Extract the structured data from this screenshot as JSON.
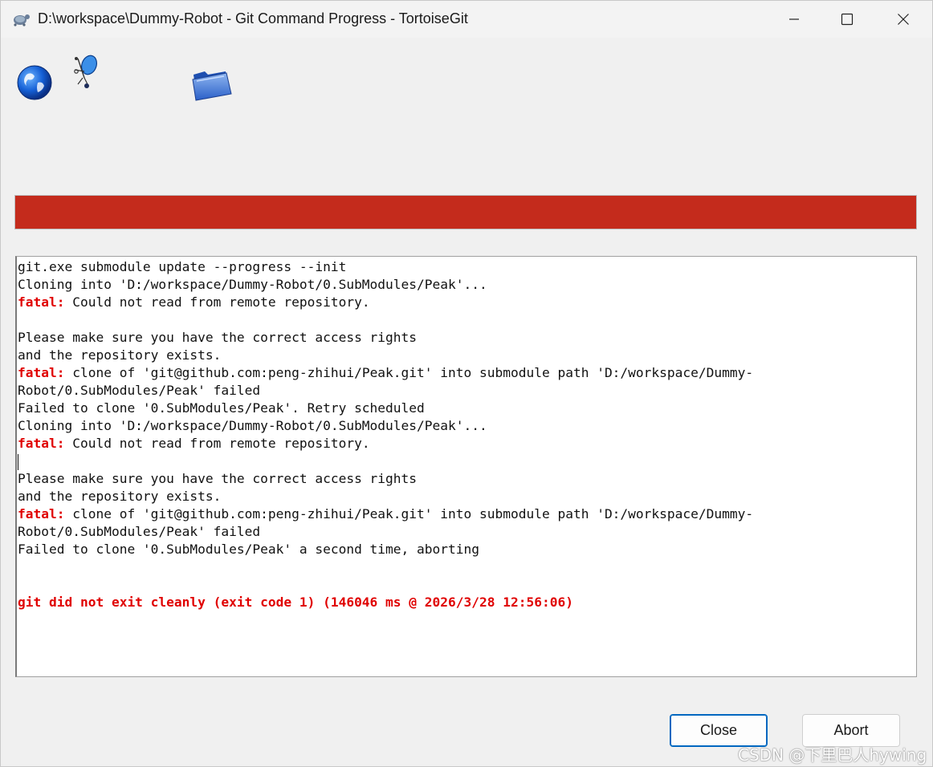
{
  "window": {
    "title": "D:\\workspace\\Dummy-Robot - Git Command Progress - TortoiseGit"
  },
  "icons": {
    "app": "tortoise-icon",
    "source": "globe-icon",
    "robot": "robot-icon",
    "destination": "folder-icon"
  },
  "progress": {
    "value": 1.0,
    "color": "#c42b1c"
  },
  "log": {
    "lines": [
      {
        "prefix": "",
        "text": "git.exe submodule update --progress --init"
      },
      {
        "prefix": "",
        "text": "Cloning into 'D:/workspace/Dummy-Robot/0.SubModules/Peak'..."
      },
      {
        "prefix": "fatal:",
        "text": " Could not read from remote repository."
      },
      {
        "prefix": "",
        "text": ""
      },
      {
        "prefix": "",
        "text": "Please make sure you have the correct access rights"
      },
      {
        "prefix": "",
        "text": "and the repository exists."
      },
      {
        "prefix": "fatal:",
        "text": " clone of 'git@github.com:peng-zhihui/Peak.git' into submodule path 'D:/workspace/Dummy-"
      },
      {
        "prefix": "",
        "text": "Robot/0.SubModules/Peak' failed"
      },
      {
        "prefix": "",
        "text": "Failed to clone '0.SubModules/Peak'. Retry scheduled"
      },
      {
        "prefix": "",
        "text": "Cloning into 'D:/workspace/Dummy-Robot/0.SubModules/Peak'..."
      },
      {
        "prefix": "fatal:",
        "text": " Could not read from remote repository."
      },
      {
        "prefix": "",
        "text": ""
      },
      {
        "prefix": "",
        "text": "Please make sure you have the correct access rights"
      },
      {
        "prefix": "",
        "text": "and the repository exists."
      },
      {
        "prefix": "fatal:",
        "text": " clone of 'git@github.com:peng-zhihui/Peak.git' into submodule path 'D:/workspace/Dummy-"
      },
      {
        "prefix": "",
        "text": "Robot/0.SubModules/Peak' failed"
      },
      {
        "prefix": "",
        "text": "Failed to clone '0.SubModules/Peak' a second time, aborting"
      },
      {
        "prefix": "",
        "text": ""
      },
      {
        "prefix": "",
        "text": ""
      }
    ],
    "summary": "git did not exit cleanly (exit code 1) (146046 ms @ 2026/3/28 12:56:06)",
    "error_color": "#e00000"
  },
  "buttons": {
    "close_label": "Close",
    "abort_label": "Abort"
  },
  "watermark": "CSDN @下里巴人hywing"
}
